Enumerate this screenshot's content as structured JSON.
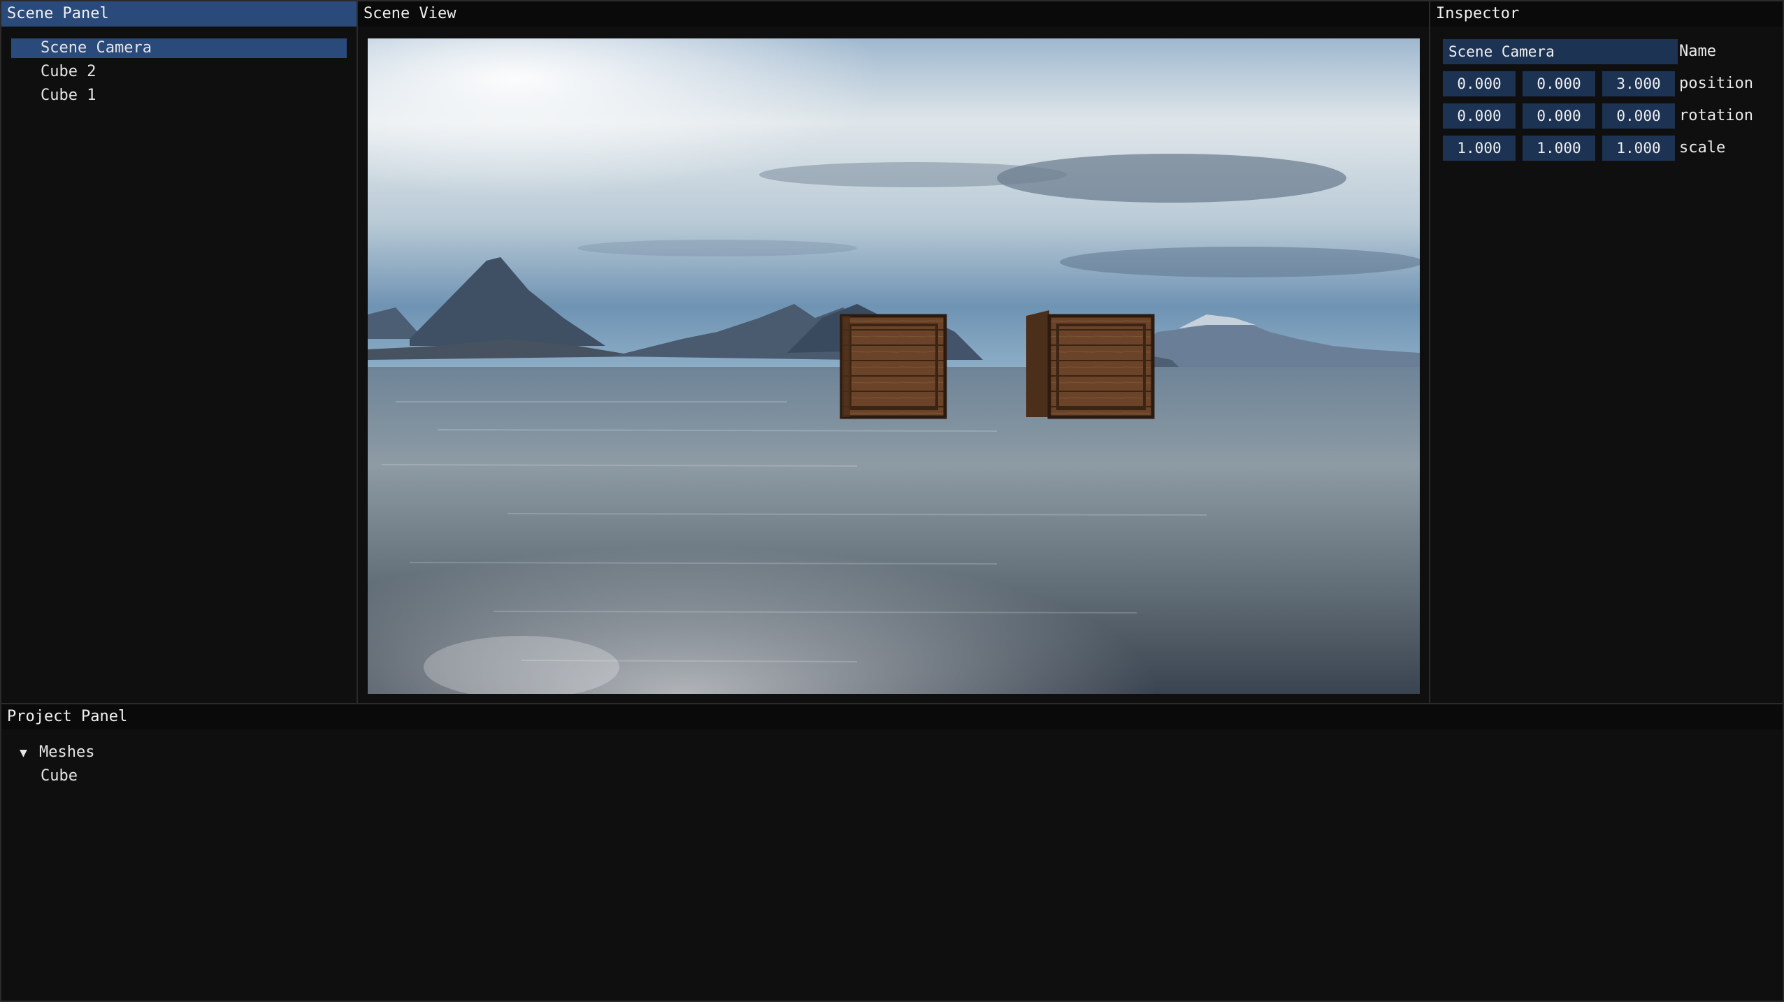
{
  "scene_panel": {
    "title": "Scene Panel",
    "items": [
      {
        "label": "Scene Camera",
        "selected": true
      },
      {
        "label": "Cube 2",
        "selected": false
      },
      {
        "label": "Cube 1",
        "selected": false
      }
    ]
  },
  "scene_view": {
    "title": "Scene View"
  },
  "inspector": {
    "title": "Inspector",
    "name_value": "Scene Camera",
    "name_label": "Name",
    "position": {
      "x": "0.000",
      "y": "0.000",
      "z": "3.000",
      "label": "position"
    },
    "rotation": {
      "x": "0.000",
      "y": "0.000",
      "z": "0.000",
      "label": "rotation"
    },
    "scale": {
      "x": "1.000",
      "y": "1.000",
      "z": "1.000",
      "label": "scale"
    }
  },
  "project_panel": {
    "title": "Project Panel",
    "folder": {
      "label": "Meshes",
      "expanded": true,
      "arrow": "▼"
    },
    "children": [
      {
        "label": "Cube"
      }
    ]
  },
  "colors": {
    "accent": "#294a7a",
    "field_bg": "#1d3354",
    "panel_bg": "#0f0f0f"
  }
}
